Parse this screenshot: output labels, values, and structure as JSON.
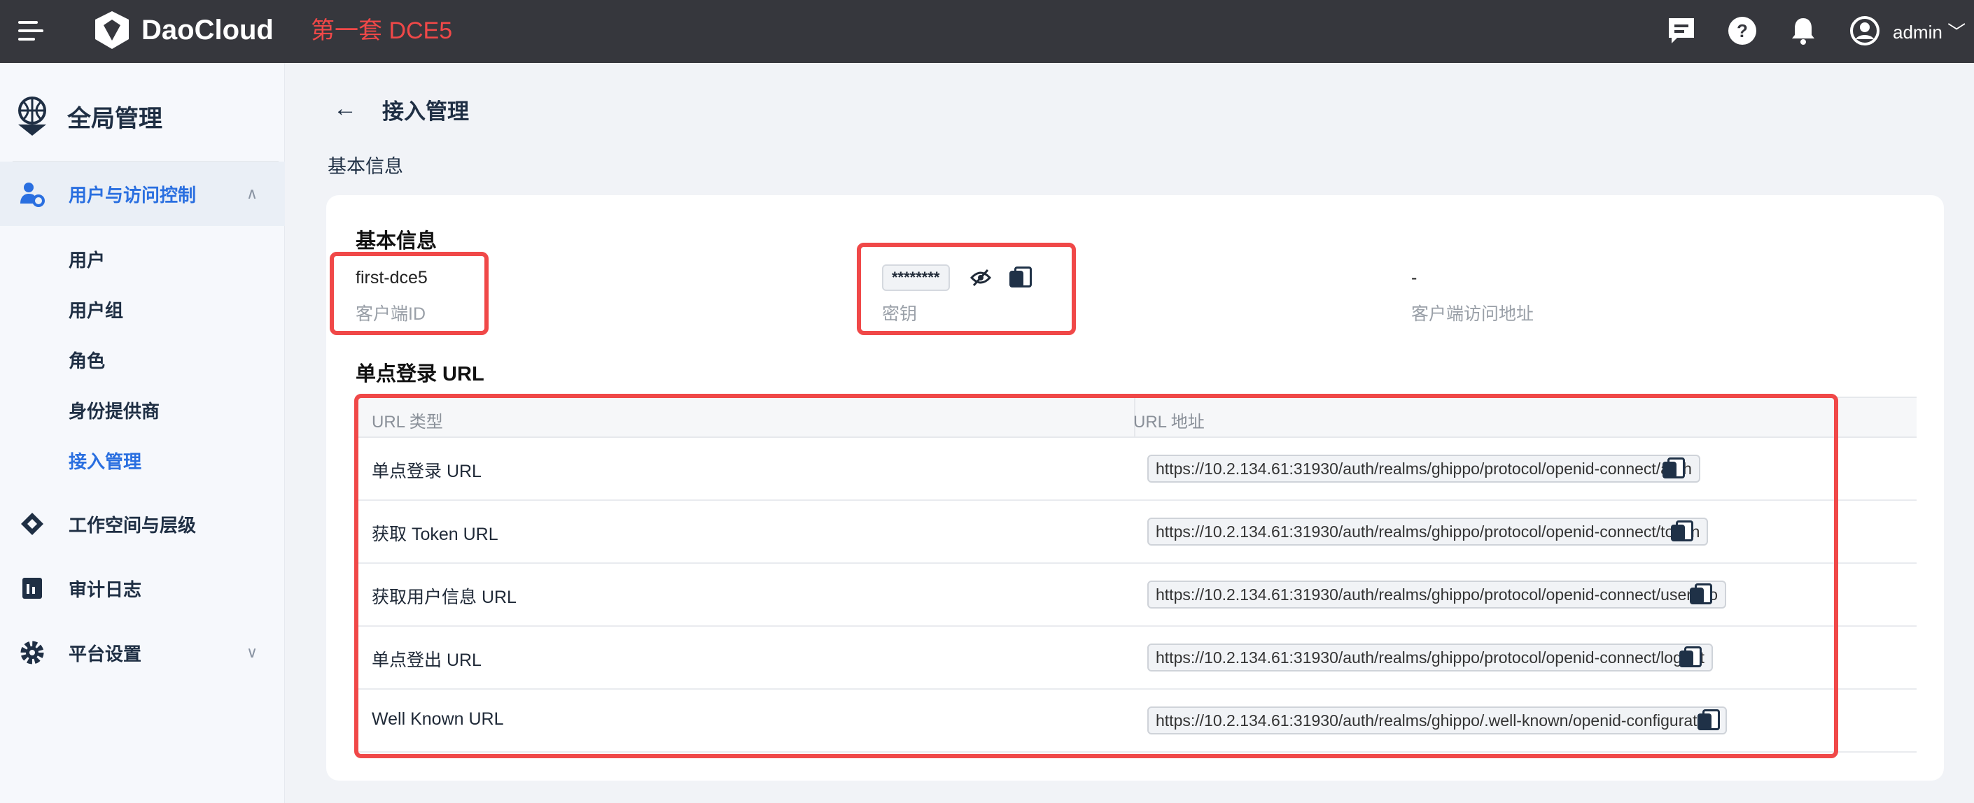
{
  "header": {
    "brand": "DaoCloud",
    "env_label": "第一套 DCE5",
    "user": "admin",
    "icons": [
      "menu-icon",
      "message-icon",
      "help-icon",
      "bell-icon",
      "user-avatar-icon"
    ]
  },
  "sidebar": {
    "title": "全局管理",
    "sections": [
      {
        "label": "用户与访问控制",
        "icon": "user-gear-icon",
        "expanded": true,
        "items": [
          "用户",
          "用户组",
          "角色",
          "身份提供商",
          "接入管理"
        ],
        "active": "接入管理"
      },
      {
        "label": "工作空间与层级",
        "icon": "workspace-icon"
      },
      {
        "label": "审计日志",
        "icon": "audit-log-icon"
      },
      {
        "label": "平台设置",
        "icon": "gear-icon",
        "expanded": false
      }
    ]
  },
  "page": {
    "title": "接入管理",
    "section": "基本信息"
  },
  "card": {
    "title": "基本信息",
    "client_id": {
      "value": "first-dce5",
      "label": "客户端ID"
    },
    "secret": {
      "value": "********",
      "label": "密钥"
    },
    "client_url": {
      "value": "-",
      "label": "客户端访问地址"
    },
    "sso_title": "单点登录 URL",
    "table": {
      "headers": [
        "URL 类型",
        "URL 地址"
      ],
      "rows": [
        {
          "type": "单点登录 URL",
          "url": "https://10.2.134.61:31930/auth/realms/ghippo/protocol/openid-connect/auth"
        },
        {
          "type": "获取 Token URL",
          "url": "https://10.2.134.61:31930/auth/realms/ghippo/protocol/openid-connect/token"
        },
        {
          "type": "获取用户信息 URL",
          "url": "https://10.2.134.61:31930/auth/realms/ghippo/protocol/openid-connect/userinfo"
        },
        {
          "type": "单点登出 URL",
          "url": "https://10.2.134.61:31930/auth/realms/ghippo/protocol/openid-connect/logout"
        },
        {
          "type": "Well Known URL",
          "url": "https://10.2.134.61:31930/auth/realms/ghippo/.well-known/openid-configuration"
        }
      ]
    }
  },
  "colors": {
    "topbar": "#36373d",
    "accent": "#2a6fe0",
    "highlight": "#f04848"
  }
}
